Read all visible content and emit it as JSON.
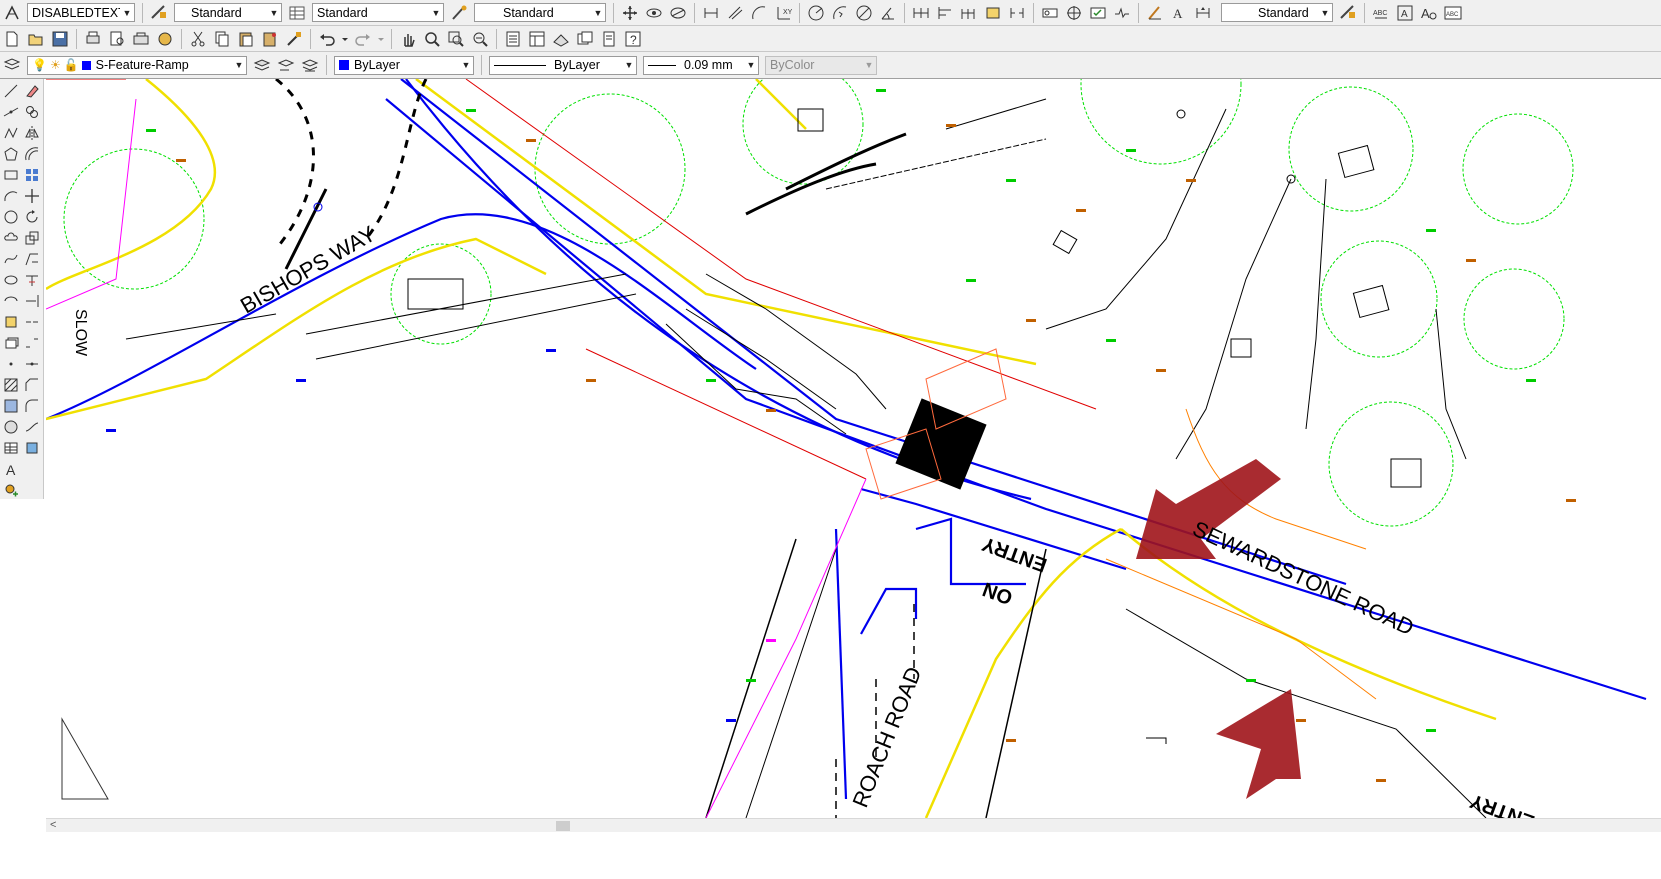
{
  "toolbar_row1": {
    "text_style": "DISABLEDTEXT",
    "dim_style": "Standard",
    "table_style": "Standard",
    "multileader_style": "Standard",
    "ml_style": "Standard"
  },
  "layer_toolbar": {
    "current_layer": "S-Feature-Ramp",
    "layer_color": "#0000ff",
    "color": "ByLayer",
    "linetype": "ByLayer",
    "lineweight": "0.09 mm",
    "plot_style": "ByColor"
  },
  "drawing": {
    "street_labels": [
      "BISHOPS WAY",
      "SLOW",
      "SEWARDSTONE ROAD",
      "ROACH ROAD",
      "ENTRY",
      "ON",
      "ENTRY"
    ],
    "annotation_arrow_color": "#a0141a"
  }
}
